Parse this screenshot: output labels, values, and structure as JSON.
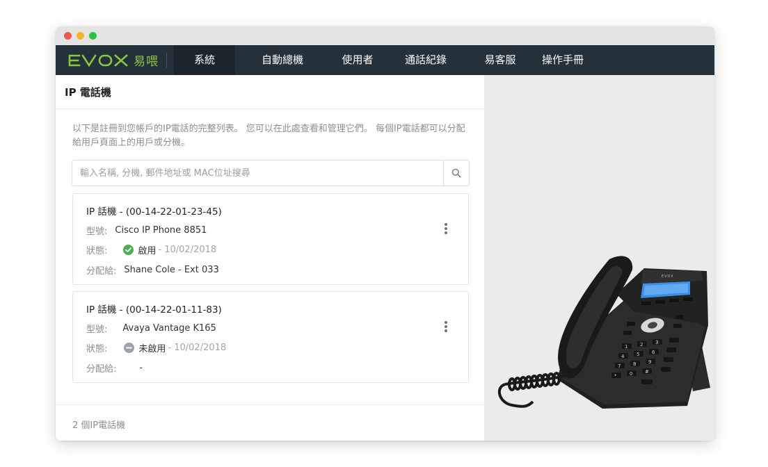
{
  "window": {
    "controls": [
      "close",
      "minimize",
      "maximize"
    ]
  },
  "brand": {
    "logo_text": "EVOX",
    "logo_cn": "易喂",
    "accent_color": "#8ec641",
    "nav_bg": "#24303a"
  },
  "nav": {
    "items": [
      {
        "label": "系統",
        "active": true
      },
      {
        "label": "自動總機",
        "active": false
      },
      {
        "label": "使用者",
        "active": false
      },
      {
        "label": "通話紀錄",
        "active": false
      },
      {
        "label": "易客服",
        "active": false
      },
      {
        "label": "操作手冊",
        "active": false
      }
    ]
  },
  "page": {
    "title": "IP 電話機",
    "description": "以下是註冊到您帳戶的IP電話的完整列表。 您可以在此處查看和管理它們。 每個IP電話都可以分配給用戶頁面上的用戶或分機。"
  },
  "search": {
    "placeholder": "輸入名稱, 分機, 郵件地址或 MAC位址搜尋",
    "value": "",
    "icon": "search-icon"
  },
  "phones": [
    {
      "title": "IP 話機 - (00-14-22-01-23-45)",
      "model_label": "型號:",
      "model": "Cisco IP Phone 8851",
      "status_label": "狀態:",
      "status": "啟用",
      "status_icon": "check-circle-icon",
      "status_color": "#4caf50",
      "date": "- 10/02/2018",
      "assigned_label": "分配給:",
      "assigned": "Shane Cole - Ext 033"
    },
    {
      "title": "IP 話機 - (00-14-22-01-11-83)",
      "model_label": "型號:",
      "model": "Avaya Vantage K165",
      "status_label": "狀態:",
      "status": "未啟用",
      "status_icon": "minus-circle-icon",
      "status_color": "#9aa3ab",
      "date": "- 10/02/2018",
      "assigned_label": "分配給:",
      "assigned": "-"
    }
  ],
  "footer": {
    "count_text": "2 個IP電話機"
  },
  "phone_image": {
    "brand_text": "EVOX",
    "keypad": [
      "1",
      "2",
      "3",
      "4",
      "5",
      "6",
      "7",
      "8",
      "9",
      "*",
      "0",
      "#"
    ]
  }
}
